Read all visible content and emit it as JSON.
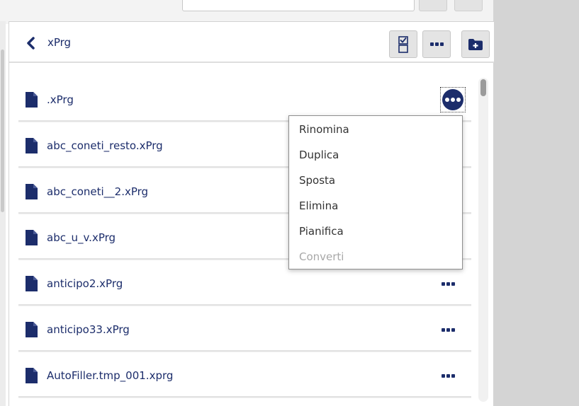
{
  "colors": {
    "accent": "#1c2d6b",
    "right_panel": "#d4d4d4",
    "menu_text": "#333333",
    "menu_disabled": "#a8a8a8"
  },
  "header": {
    "back_icon": "chevron-left-icon",
    "folder_title": "xPrg",
    "select_icon": "checklist-icon",
    "more_icon": "more-horizontal-icon",
    "new_folder_icon": "folder-plus-icon"
  },
  "files": [
    {
      "name": ".xPrg",
      "icon": "file-icon",
      "menu_open": true
    },
    {
      "name": "abc_coneti_resto.xPrg",
      "icon": "file-icon"
    },
    {
      "name": "abc_coneti__2.xPrg",
      "icon": "file-icon"
    },
    {
      "name": "abc_u_v.xPrg",
      "icon": "file-icon"
    },
    {
      "name": "anticipo2.xPrg",
      "icon": "file-icon"
    },
    {
      "name": "anticipo33.xPrg",
      "icon": "file-icon"
    },
    {
      "name": "AutoFiller.tmp_001.xprg",
      "icon": "file-icon"
    }
  ],
  "context_menu": {
    "items": [
      {
        "label": "Rinomina",
        "enabled": true
      },
      {
        "label": "Duplica",
        "enabled": true
      },
      {
        "label": "Sposta",
        "enabled": true
      },
      {
        "label": "Elimina",
        "enabled": true
      },
      {
        "label": "Pianifica",
        "enabled": true
      },
      {
        "label": "Converti",
        "enabled": false
      }
    ]
  }
}
